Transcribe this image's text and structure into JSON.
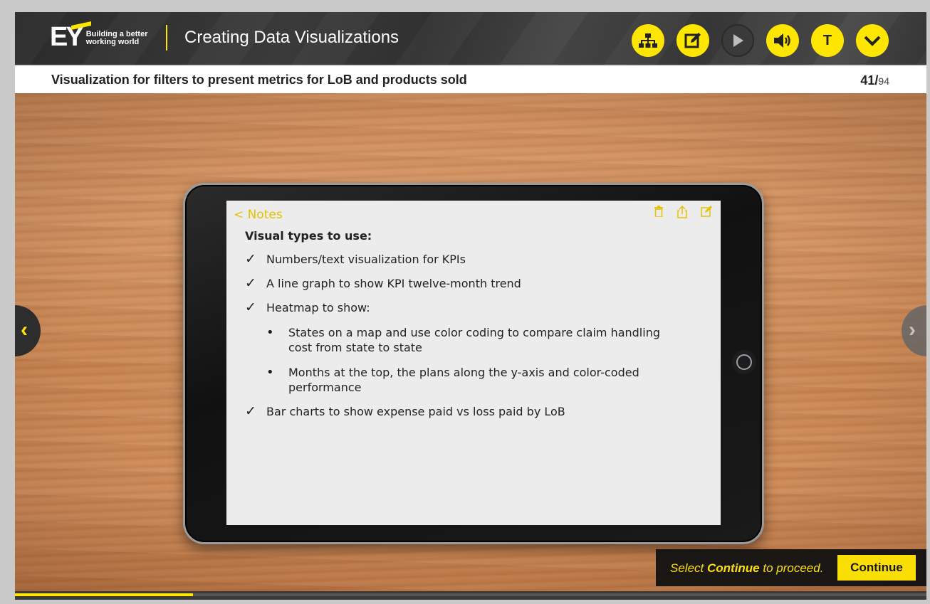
{
  "brand": {
    "mark": "EY",
    "tagline_line1": "Building a better",
    "tagline_line2": "working world"
  },
  "course_title": "Creating Data Visualizations",
  "toolbar": {
    "items": [
      {
        "icon": "sitemap-icon"
      },
      {
        "icon": "notes-edit-icon"
      },
      {
        "icon": "play-icon"
      },
      {
        "icon": "volume-icon"
      },
      {
        "icon": "transcript-icon",
        "label": "T"
      },
      {
        "icon": "chevron-down-icon"
      }
    ]
  },
  "slide": {
    "title": "Visualization for filters to present metrics for LoB and products sold",
    "current": "41",
    "total": "94"
  },
  "notes": {
    "back_label": "< Notes",
    "heading": "Visual types to use:",
    "items": [
      {
        "text": "Numbers/text visualization for KPIs"
      },
      {
        "text": "A line graph to show KPI twelve-month trend"
      },
      {
        "text": "Heatmap to show:"
      },
      {
        "text": "States on a map and use color coding to compare claim handling cost from state to state"
      },
      {
        "text": "Months at the top, the plans along the y-axis and color-coded performance"
      },
      {
        "text": "Bar charts to show expense paid vs loss paid by LoB"
      }
    ]
  },
  "continue": {
    "prefix": "Select ",
    "keyword": "Continue",
    "suffix": " to proceed.",
    "button_label": "Continue"
  },
  "progress": {
    "fraction": 0.195
  },
  "colors": {
    "accent": "#ffe600",
    "dark": "#3a3a3a"
  }
}
